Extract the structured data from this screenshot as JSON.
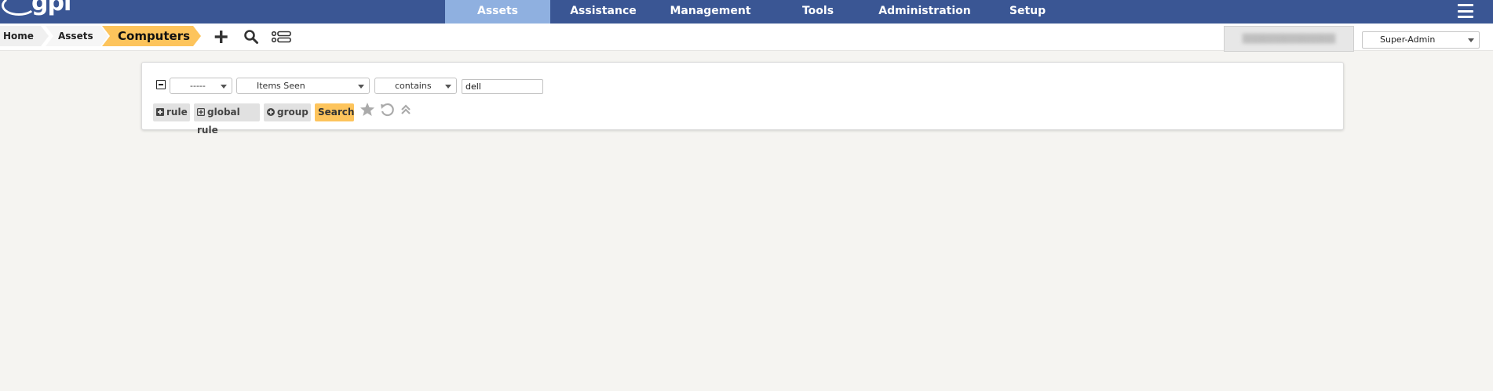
{
  "app": {
    "logo_text": "glpi"
  },
  "nav": {
    "items": [
      {
        "label": "Assets",
        "active": true
      },
      {
        "label": "Assistance",
        "active": false
      },
      {
        "label": "Management",
        "active": false
      },
      {
        "label": "Tools",
        "active": false
      },
      {
        "label": "Administration",
        "active": false
      },
      {
        "label": "Setup",
        "active": false
      }
    ]
  },
  "breadcrumb": {
    "items": [
      "Home",
      "Assets",
      "Computers"
    ]
  },
  "toolbar": {
    "icons": [
      "plus-icon",
      "search-icon",
      "list-view-icon"
    ]
  },
  "header_right": {
    "profile_select": "Super-Admin"
  },
  "search": {
    "link_operator": "-----",
    "field": "Items Seen",
    "operator": "contains",
    "value": "dell",
    "buttons": {
      "rule": "rule",
      "global_rule": "global rule",
      "group": "group",
      "search": "Search"
    },
    "icons": [
      "star-icon",
      "reset-icon",
      "collapse-icon"
    ]
  },
  "colors": {
    "topbar": "#3a5694",
    "nav_active": "#8fb0e0",
    "accent": "#fdc45c",
    "background": "#f5f4f1"
  }
}
